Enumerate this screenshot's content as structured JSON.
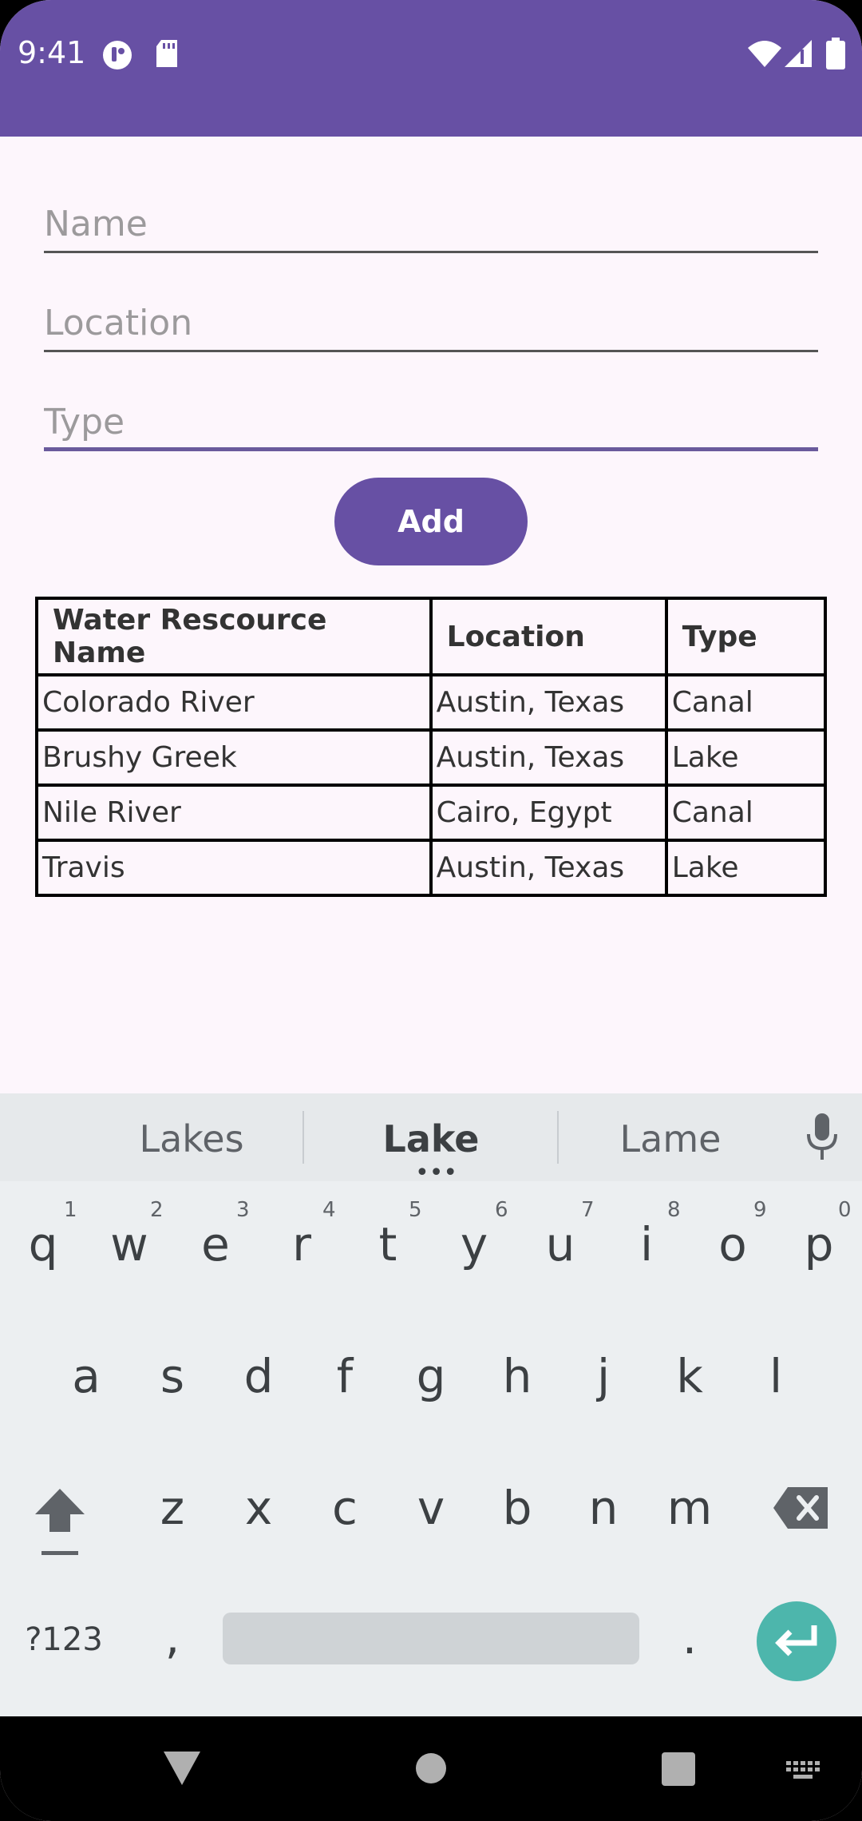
{
  "status": {
    "time": "9:41"
  },
  "form": {
    "name_placeholder": "Name",
    "location_placeholder": "Location",
    "type_placeholder": "Type",
    "add_label": "Add"
  },
  "table": {
    "headers": [
      "Water Rescource Name",
      "Location",
      "Type"
    ],
    "rows": [
      [
        "Colorado River",
        "Austin, Texas",
        "Canal"
      ],
      [
        "Brushy Greek",
        "Austin, Texas",
        "Lake"
      ],
      [
        "Nile River",
        "Cairo, Egypt",
        "Canal"
      ],
      [
        "Travis",
        "Austin, Texas",
        "Lake"
      ]
    ]
  },
  "keyboard": {
    "suggestions": [
      "Lakes",
      "Lake",
      "Lame"
    ],
    "row1": [
      "q",
      "w",
      "e",
      "r",
      "t",
      "y",
      "u",
      "i",
      "o",
      "p"
    ],
    "row1_hints": [
      "1",
      "2",
      "3",
      "4",
      "5",
      "6",
      "7",
      "8",
      "9",
      "0"
    ],
    "row2": [
      "a",
      "s",
      "d",
      "f",
      "g",
      "h",
      "j",
      "k",
      "l"
    ],
    "row3": [
      "z",
      "x",
      "c",
      "v",
      "b",
      "n",
      "m"
    ],
    "symbols_label": "?123",
    "comma": ",",
    "period": "."
  },
  "colors": {
    "accent": "#6750a4",
    "background": "#fdf6fc",
    "enter": "#4db6ac"
  }
}
